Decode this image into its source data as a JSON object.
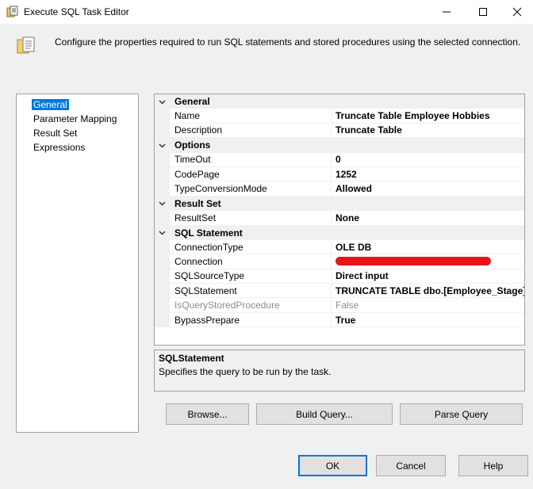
{
  "window": {
    "title": "Execute SQL Task Editor"
  },
  "header": {
    "description": "Configure the properties required to run SQL statements and stored procedures using the selected connection."
  },
  "nav": {
    "items": [
      {
        "label": "General",
        "selected": true
      },
      {
        "label": "Parameter Mapping",
        "selected": false
      },
      {
        "label": "Result Set",
        "selected": false
      },
      {
        "label": "Expressions",
        "selected": false
      }
    ]
  },
  "grid": {
    "categories": [
      {
        "label": "General",
        "properties": [
          {
            "name": "Name",
            "value": "Truncate Table Employee Hobbies"
          },
          {
            "name": "Description",
            "value": "Truncate Table"
          }
        ]
      },
      {
        "label": "Options",
        "properties": [
          {
            "name": "TimeOut",
            "value": "0"
          },
          {
            "name": "CodePage",
            "value": "1252"
          },
          {
            "name": "TypeConversionMode",
            "value": "Allowed"
          }
        ]
      },
      {
        "label": "Result Set",
        "properties": [
          {
            "name": "ResultSet",
            "value": "None"
          }
        ]
      },
      {
        "label": "SQL Statement",
        "properties": [
          {
            "name": "ConnectionType",
            "value": "OLE DB"
          },
          {
            "name": "Connection",
            "value": ""
          },
          {
            "name": "SQLSourceType",
            "value": "Direct input"
          },
          {
            "name": "SQLStatement",
            "value": "TRUNCATE TABLE dbo.[Employee_Stage] G"
          },
          {
            "name": "IsQueryStoredProcedure",
            "value": "False"
          },
          {
            "name": "BypassPrepare",
            "value": "True"
          }
        ]
      }
    ]
  },
  "description_panel": {
    "title": "SQLStatement",
    "text": "Specifies the query to be run by the task."
  },
  "buttons": {
    "browse": "Browse...",
    "build_query": "Build Query...",
    "parse_query": "Parse Query",
    "ok": "OK",
    "cancel": "Cancel",
    "help": "Help"
  },
  "colors": {
    "selection": "#0078d7",
    "redaction": "#e8141b"
  }
}
